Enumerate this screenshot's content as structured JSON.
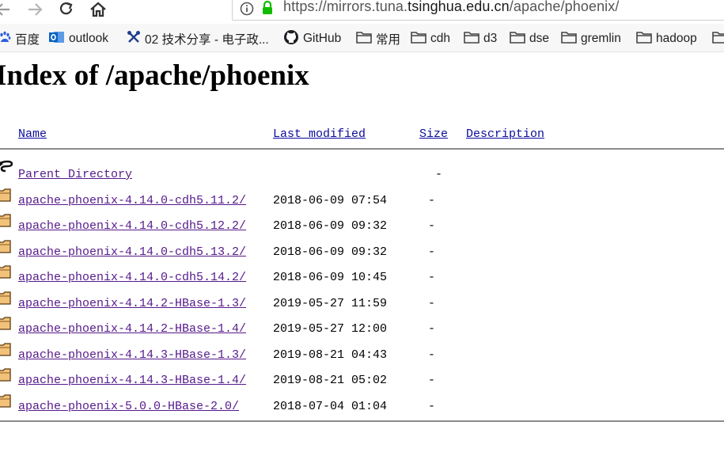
{
  "browser": {
    "url_prefix": "https://mirrors.tuna.",
    "url_host": "tsinghua.edu.cn",
    "url_path": "/apache/phoenix/"
  },
  "bookmarks": [
    {
      "label": "百度",
      "icon": "baidu-icon"
    },
    {
      "label": "outlook",
      "icon": "outlook-icon"
    },
    {
      "label": "02 技术分享 - 电子政...",
      "icon": "tools-icon"
    },
    {
      "label": "GitHub",
      "icon": "github-icon"
    },
    {
      "label": "常用",
      "icon": "folder-icon"
    },
    {
      "label": "cdh",
      "icon": "folder-icon"
    },
    {
      "label": "d3",
      "icon": "folder-icon"
    },
    {
      "label": "dse",
      "icon": "folder-icon"
    },
    {
      "label": "gremlin",
      "icon": "folder-icon"
    },
    {
      "label": "hadoop",
      "icon": "folder-icon"
    }
  ],
  "page": {
    "title": "Index of /apache/phoenix",
    "columns": {
      "name": "Name",
      "modified": "Last modified",
      "size": "Size",
      "description": "Description"
    },
    "parent": {
      "name": "Parent Directory",
      "size": "-"
    },
    "rows": [
      {
        "name": "apache-phoenix-4.14.0-cdh5.11.2/",
        "modified": "2018-06-09 07:54",
        "size": "-"
      },
      {
        "name": "apache-phoenix-4.14.0-cdh5.12.2/",
        "modified": "2018-06-09 09:32",
        "size": "-"
      },
      {
        "name": "apache-phoenix-4.14.0-cdh5.13.2/",
        "modified": "2018-06-09 09:32",
        "size": "-"
      },
      {
        "name": "apache-phoenix-4.14.0-cdh5.14.2/",
        "modified": "2018-06-09 10:45",
        "size": "-"
      },
      {
        "name": "apache-phoenix-4.14.2-HBase-1.3/",
        "modified": "2019-05-27 11:59",
        "size": "-"
      },
      {
        "name": "apache-phoenix-4.14.2-HBase-1.4/",
        "modified": "2019-05-27 12:00",
        "size": "-"
      },
      {
        "name": "apache-phoenix-4.14.3-HBase-1.3/",
        "modified": "2019-08-21 04:43",
        "size": "-"
      },
      {
        "name": "apache-phoenix-4.14.3-HBase-1.4/",
        "modified": "2019-08-21 05:02",
        "size": "-"
      },
      {
        "name": "apache-phoenix-5.0.0-HBase-2.0/",
        "modified": "2018-07-04 01:04",
        "size": "-"
      }
    ]
  }
}
